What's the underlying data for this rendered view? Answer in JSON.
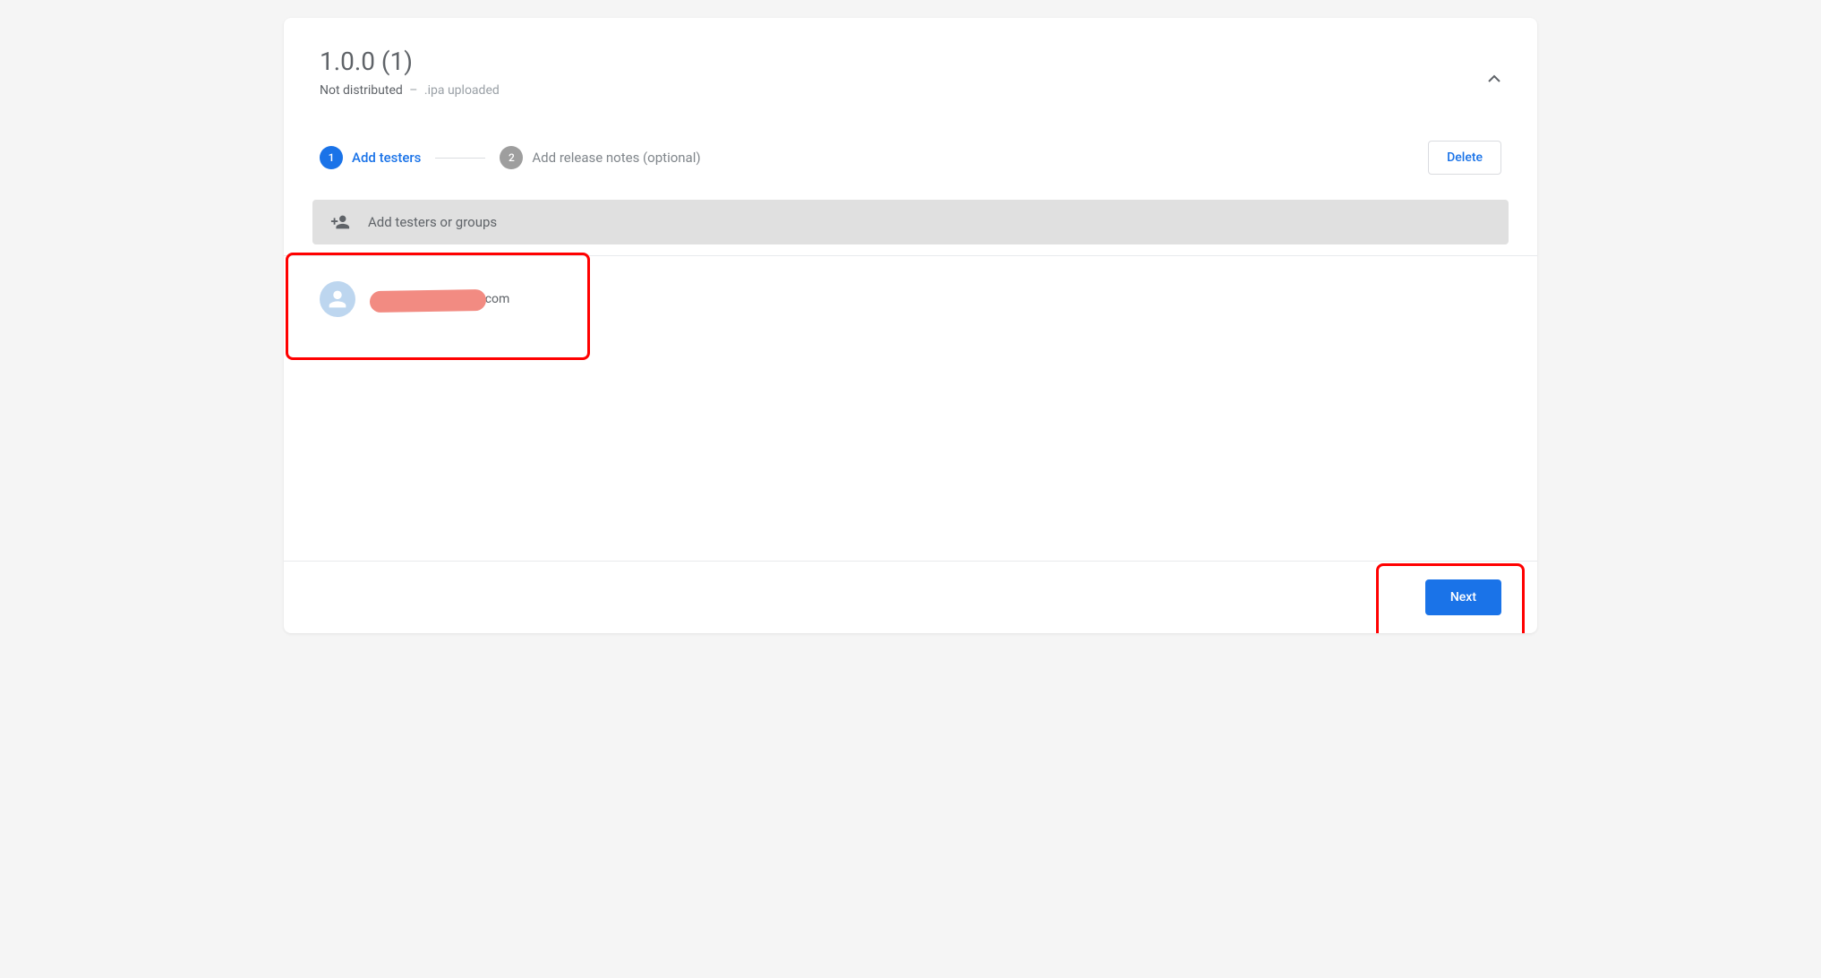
{
  "release": {
    "version_title": "1.0.0 (1)",
    "status": "Not distributed",
    "status_detail": ".ipa uploaded"
  },
  "stepper": {
    "step1": {
      "number": "1",
      "label": "Add testers"
    },
    "step2": {
      "number": "2",
      "label": "Add release notes (optional)"
    }
  },
  "actions": {
    "delete": "Delete",
    "next": "Next"
  },
  "search": {
    "placeholder": "Add testers or groups"
  },
  "testers": [
    {
      "email_suffix": ".com"
    }
  ]
}
